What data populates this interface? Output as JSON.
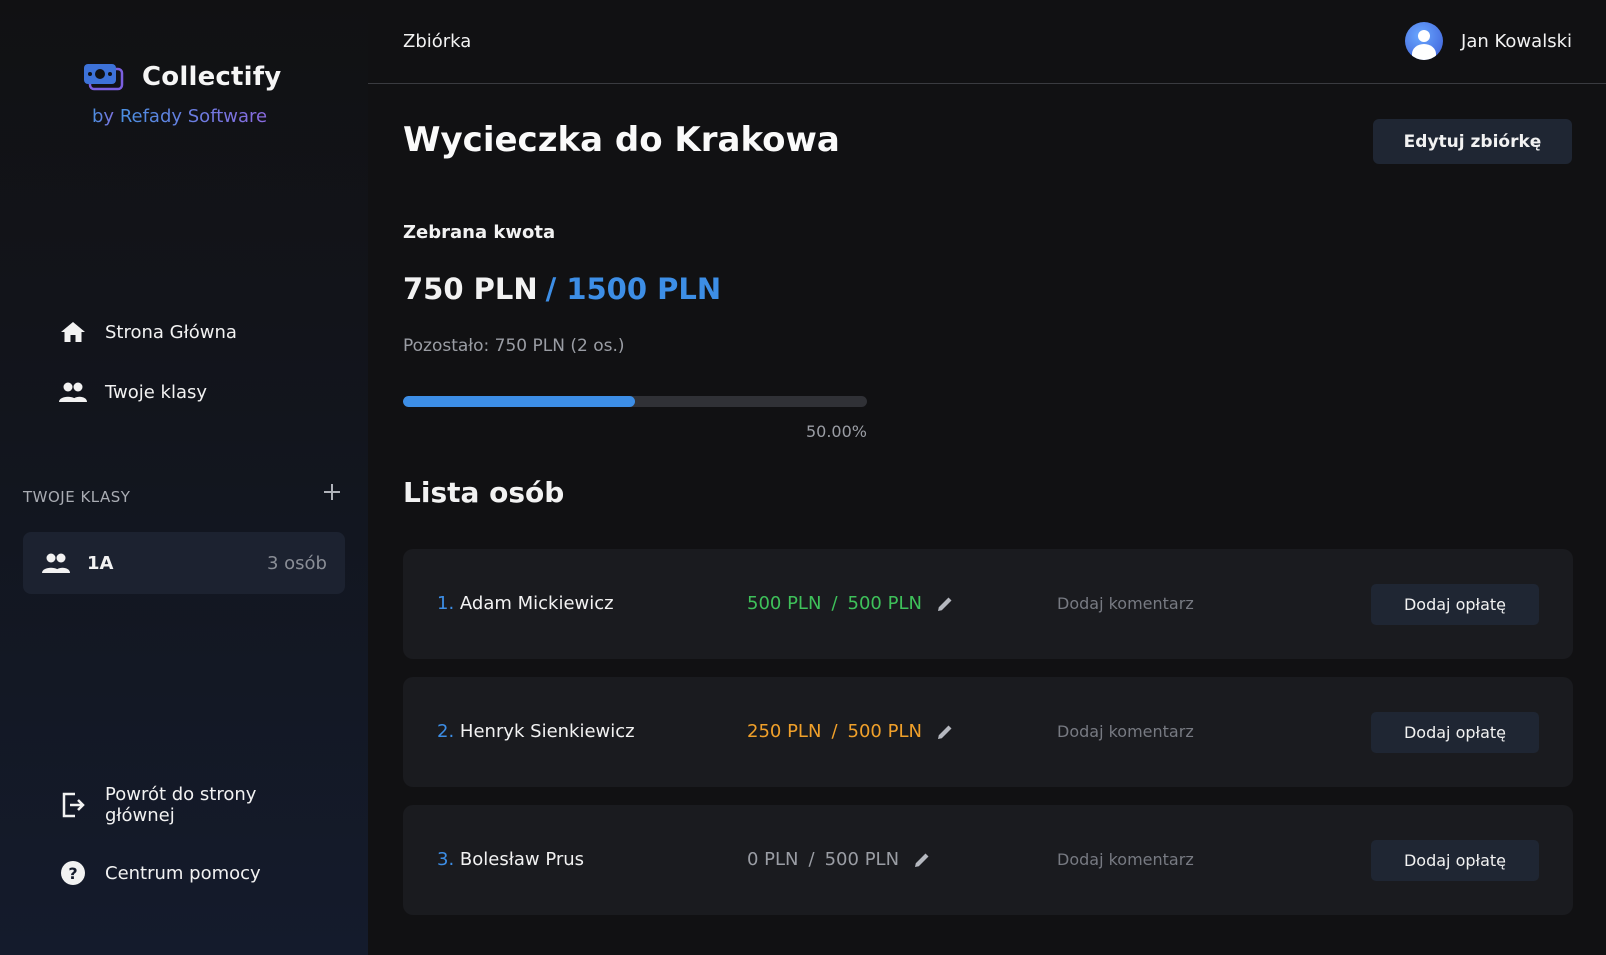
{
  "colors": {
    "accent_blue": "#3d8ee6",
    "paid_full": "#3ec15a",
    "paid_partial": "#f0a02a",
    "paid_none": "#9a9da4"
  },
  "sidebar": {
    "logo_name": "Collectify",
    "logo_sub_prefix": "by ",
    "logo_sub_brand": "Refady Software",
    "nav": [
      {
        "label": "Strona Główna",
        "icon": "home-icon"
      },
      {
        "label": "Twoje klasy",
        "icon": "users-icon"
      }
    ],
    "section_title": "TWOJE KLASY",
    "classes": [
      {
        "name": "1A",
        "count": "3 osób"
      }
    ],
    "bottom": [
      {
        "label": "Powrót do strony głównej",
        "icon": "exit-icon"
      },
      {
        "label": "Centrum pomocy",
        "icon": "help-icon"
      }
    ]
  },
  "header": {
    "breadcrumb": "Zbiórka",
    "user_name": "Jan Kowalski"
  },
  "main": {
    "title": "Wycieczka do Krakowa",
    "edit_button": "Edytuj zbiórkę",
    "collected_label": "Zebrana kwota",
    "collected": "750 PLN",
    "goal": "/ 1500 PLN",
    "remaining": "Pozostało: 750 PLN (2 os.)",
    "progress_fraction": 0.5,
    "progress_text": "50.00%",
    "list_title": "Lista osób",
    "people": [
      {
        "num": "1.",
        "name": "Adam Mickiewicz",
        "paid": "500 PLN",
        "due": "500 PLN",
        "status_color": "#3ec15a",
        "comment": "Dodaj komentarz",
        "button": "Dodaj opłatę"
      },
      {
        "num": "2.",
        "name": "Henryk Sienkiewicz",
        "paid": "250 PLN",
        "due": "500 PLN",
        "status_color": "#f0a02a",
        "comment": "Dodaj komentarz",
        "button": "Dodaj opłatę"
      },
      {
        "num": "3.",
        "name": "Bolesław Prus",
        "paid": "0 PLN",
        "due": "500 PLN",
        "status_color": "#9a9da4",
        "comment": "Dodaj komentarz",
        "button": "Dodaj opłatę"
      }
    ]
  }
}
